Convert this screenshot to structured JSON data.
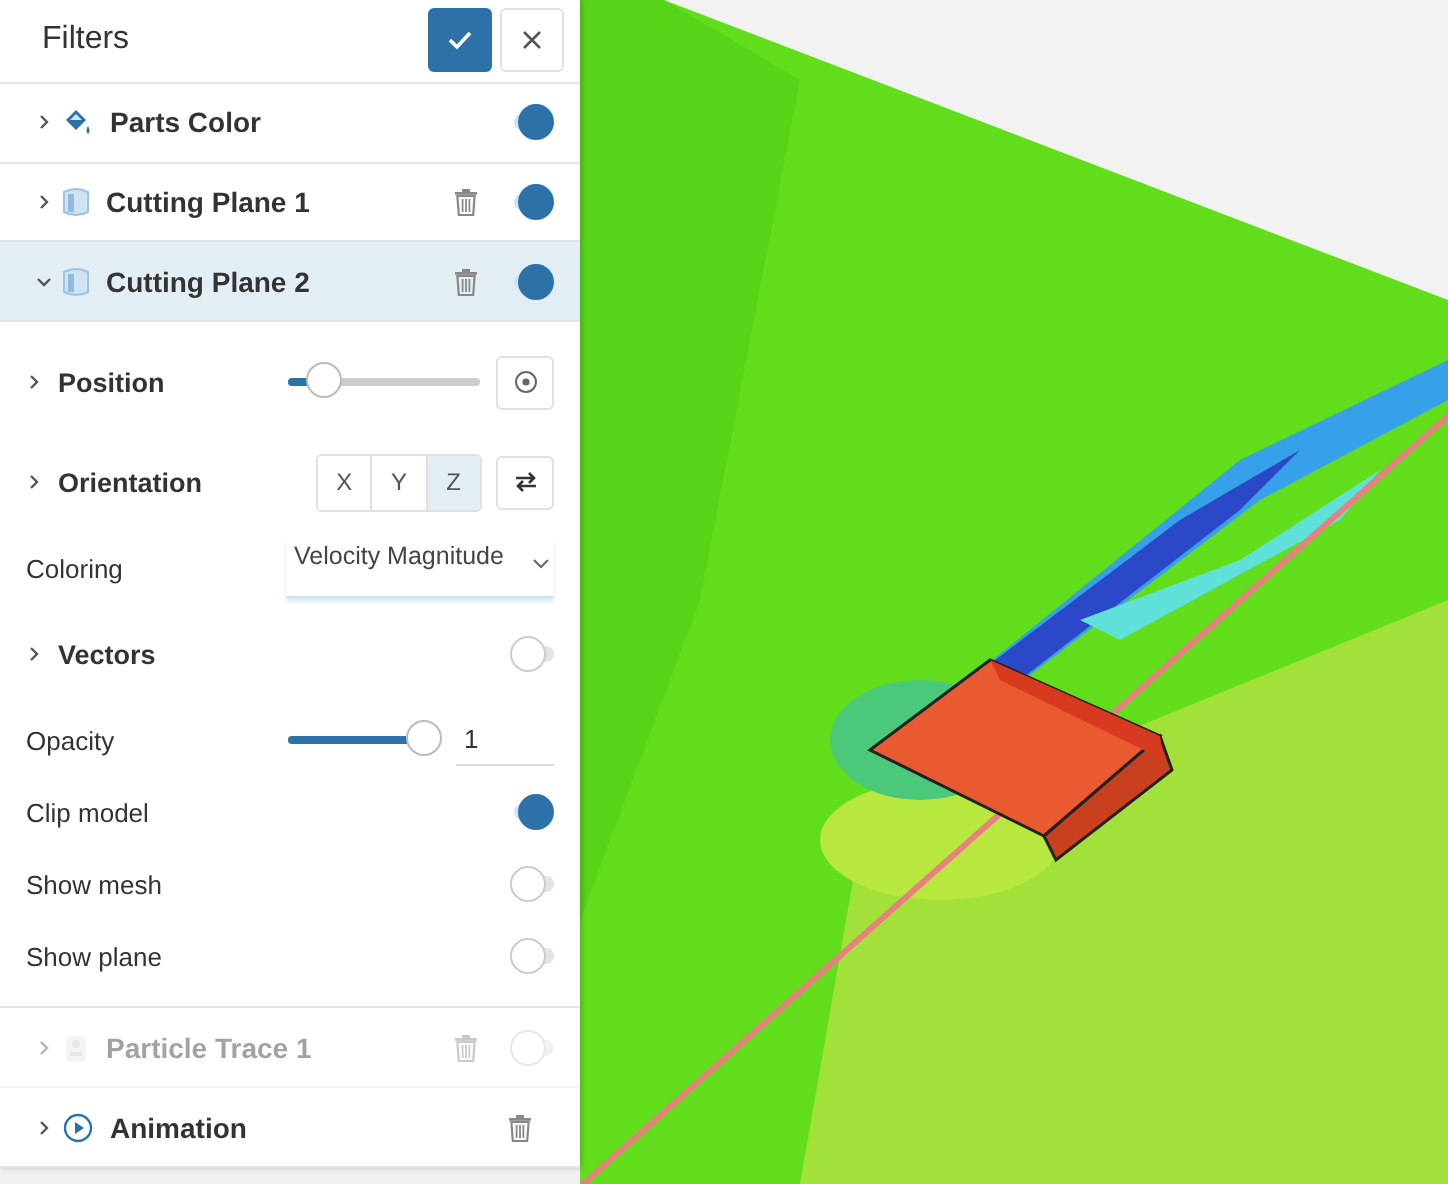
{
  "panel": {
    "title": "Filters"
  },
  "filters": [
    {
      "name": "Parts Color",
      "kind": "paint",
      "expanded": false,
      "selected": false,
      "disabled": false,
      "deletable": false,
      "on": true
    },
    {
      "name": "Cutting Plane 1",
      "kind": "plane",
      "expanded": false,
      "selected": false,
      "disabled": false,
      "deletable": true,
      "on": true
    },
    {
      "name": "Cutting Plane 2",
      "kind": "plane",
      "expanded": true,
      "selected": true,
      "disabled": false,
      "deletable": true,
      "on": true,
      "settings": [
        {
          "kind": "slider",
          "label": "Position",
          "expandable": true,
          "level": 0.19
        },
        {
          "kind": "axis",
          "label": "Orientation",
          "expandable": true,
          "axes": [
            {
              "label": "X",
              "selected": false
            },
            {
              "label": "Y",
              "selected": false
            },
            {
              "label": "Z",
              "selected": true
            }
          ]
        },
        {
          "kind": "select",
          "label": "Coloring",
          "expandable": false,
          "value": "Velocity Magnitude"
        },
        {
          "kind": "toggle",
          "label": "Vectors",
          "expandable": true,
          "on": false
        },
        {
          "kind": "value-slider",
          "label": "Opacity",
          "expandable": false,
          "level": 1,
          "value": "1"
        },
        {
          "kind": "toggle",
          "label": "Clip model",
          "expandable": false,
          "on": true
        },
        {
          "kind": "toggle",
          "label": "Show mesh",
          "expandable": false,
          "on": false
        },
        {
          "kind": "toggle",
          "label": "Show plane",
          "expandable": false,
          "on": false
        }
      ]
    },
    {
      "name": "Particle Trace 1",
      "kind": "particle",
      "expanded": false,
      "selected": false,
      "disabled": true,
      "deletable": true,
      "on": false
    },
    {
      "name": "Animation",
      "kind": "animation",
      "expanded": false,
      "selected": false,
      "disabled": false,
      "deletable": true
    }
  ]
}
